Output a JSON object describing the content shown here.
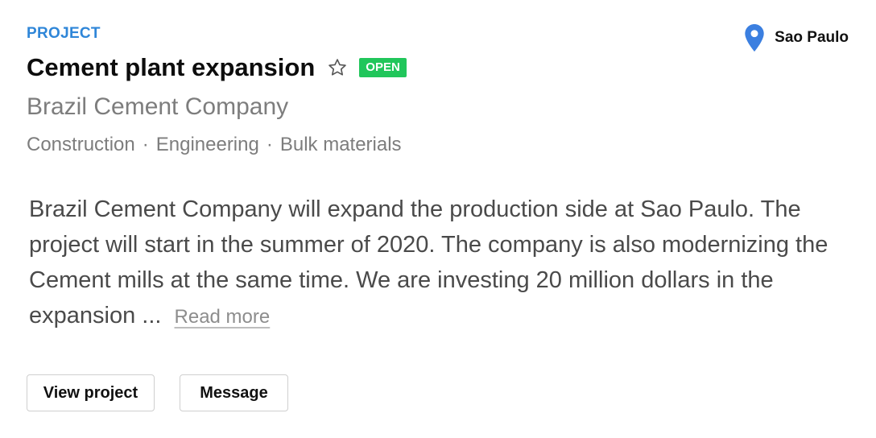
{
  "project": {
    "eyebrow": "PROJECT",
    "title": "Cement plant expansion",
    "status_badge": "OPEN",
    "company": "Brazil Cement Company",
    "tags": [
      "Construction",
      "Engineering",
      "Bulk materials"
    ],
    "tag_separator": "·",
    "location": "Sao Paulo",
    "description": "Brazil Cement Company will expand the production side at Sao Paulo. The project will start in the summer of 2020. The company is also modernizing the Cement mills at the same time. We are investing 20 million dollars in the expansion ...",
    "read_more": "Read more"
  },
  "actions": {
    "view_project": "View project",
    "message": "Message"
  },
  "icons": {
    "location": "map-pin-icon",
    "favorite": "star-outline-icon"
  },
  "colors": {
    "eyebrow": "#2f86d8",
    "pin": "#3b7fe0",
    "badge_bg": "#21c65b",
    "muted_text": "#7d7d7d"
  }
}
